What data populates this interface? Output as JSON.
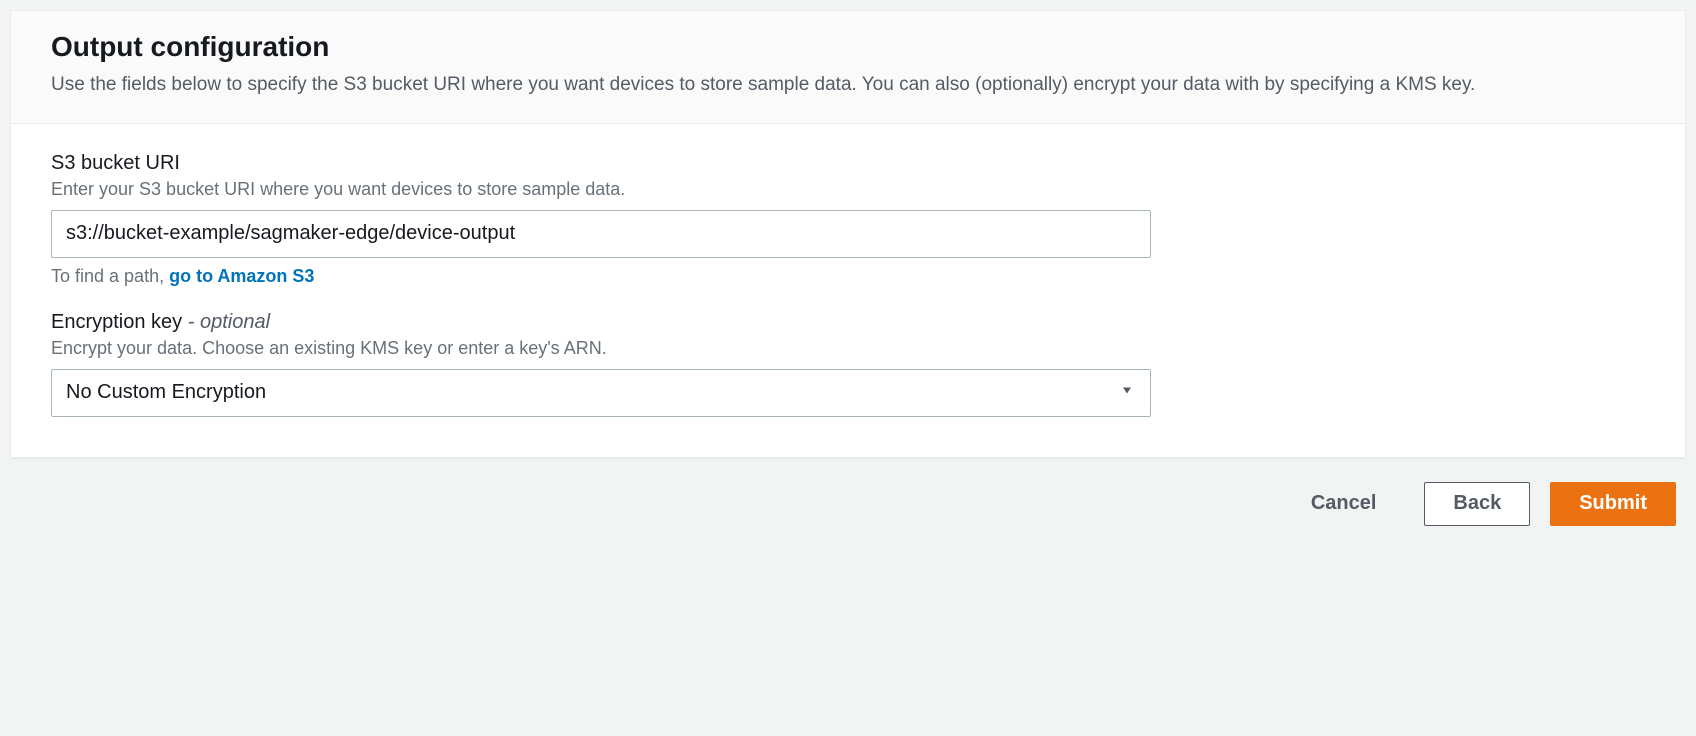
{
  "panel": {
    "title": "Output configuration",
    "description": "Use the fields below to specify the S3 bucket URI where you want devices to store sample data. You can also (optionally) encrypt your data with by specifying a KMS key."
  },
  "s3": {
    "label": "S3 bucket URI",
    "description": "Enter your S3 bucket URI where you want devices to store sample data.",
    "value": "s3://bucket-example/sagmaker-edge/device-output",
    "constraint_prefix": "To find a path, ",
    "constraint_link": "go to Amazon S3"
  },
  "encryption": {
    "label_main": "Encryption key ",
    "label_suffix": "- optional",
    "description": "Encrypt your data. Choose an existing KMS key or enter a key's ARN.",
    "selected": "No Custom Encryption"
  },
  "buttons": {
    "cancel": "Cancel",
    "back": "Back",
    "submit": "Submit"
  }
}
